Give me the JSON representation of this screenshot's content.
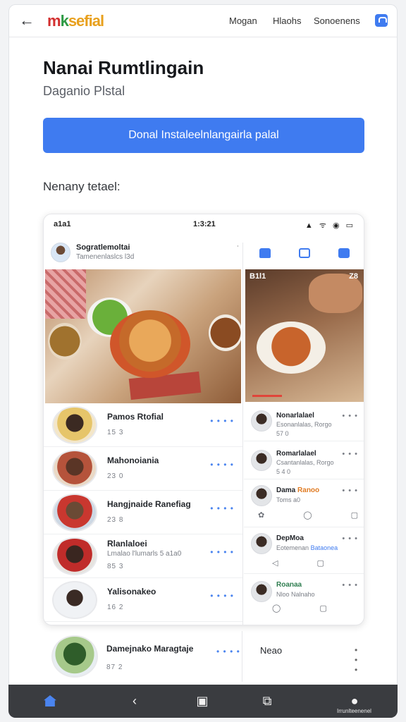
{
  "header": {
    "back_icon": "arrow-left-icon",
    "logo": {
      "part1": "m",
      "part2": "k",
      "part3": "sefial"
    },
    "nav": [
      "Mogan",
      "Hlaohs",
      "Sonoenens"
    ],
    "account_icon": "bookmark-icon"
  },
  "hero": {
    "title": "Nanai Rumtlingain",
    "subtitle": "Daganio Plstal",
    "cta": "Donal Instaleelnlangairla palal",
    "section": "Nenany tetael:"
  },
  "phone": {
    "status_left": "a1a1",
    "status_center": "1:3:21",
    "status_icons": "▲ ᯤ ◉ ▭",
    "profile_name": "Sogratlemoltai",
    "profile_meta": "Tamenenlaslcs l3d",
    "tabs": [
      "home-tab-icon",
      "bag-tab-icon",
      "grid-tab-icon"
    ],
    "video_overlay": "B1l1",
    "video_close": "Z8",
    "left_list": [
      {
        "name": "Pamos Rtofial",
        "meta": "15 3",
        "dots": "• • • •"
      },
      {
        "name": "Mahonoiania",
        "meta": "23 0",
        "dots": "• • • •"
      },
      {
        "name": "Hangjnaide Ranefiag",
        "meta": "23 8",
        "dots": "• • • •"
      },
      {
        "name": "Rlanlaloei",
        "sub": "Lmalao l'lumarls 5 a1a0",
        "meta": "85 3",
        "dots": "• • • •"
      },
      {
        "name": "Yalisonakeo",
        "meta": "16 2",
        "dots": "• • • •"
      }
    ],
    "right_list": [
      {
        "name": "Nonarlalael",
        "meta": "Esonanlalas, Rorgo",
        "meta2": "57 0",
        "dots": "• • •"
      },
      {
        "name": "Romarlalael",
        "meta": "Csantanlalas, Rorgo",
        "meta2": "5 4 0",
        "dots": "• • •"
      },
      {
        "name": "Dama",
        "tag": "Ranoo",
        "meta": "Toms a0",
        "dots": "• • •",
        "actions": "✿ ◯ ▢ ◑"
      },
      {
        "name": "DepMoa",
        "meta": "Eotemenan",
        "tag": "Bataonea",
        "dots": "• • •",
        "actions": "◁ ▢ ♡"
      },
      {
        "name": "Roanaa",
        "meta": "Nloo Nalnaho",
        "dots": "• • •",
        "actions": "◯ ▢ ◑"
      }
    ]
  },
  "outside_row": {
    "name": "Damejnako Maragtaje",
    "meta": "87 2",
    "dots": "• • • •",
    "name2": "Neao",
    "dots2": "• • •"
  },
  "bottom_nav": {
    "items": [
      "home-icon",
      "back-chevron-icon",
      "bag-icon",
      "share-icon",
      "profile-icon"
    ],
    "profile_label": "Irrunlteenenel"
  },
  "colors": {
    "accent": "#3f7bf0",
    "dark_bar": "#3a3c40",
    "logo_red": "#d32f2f",
    "logo_green": "#2e9a45"
  }
}
